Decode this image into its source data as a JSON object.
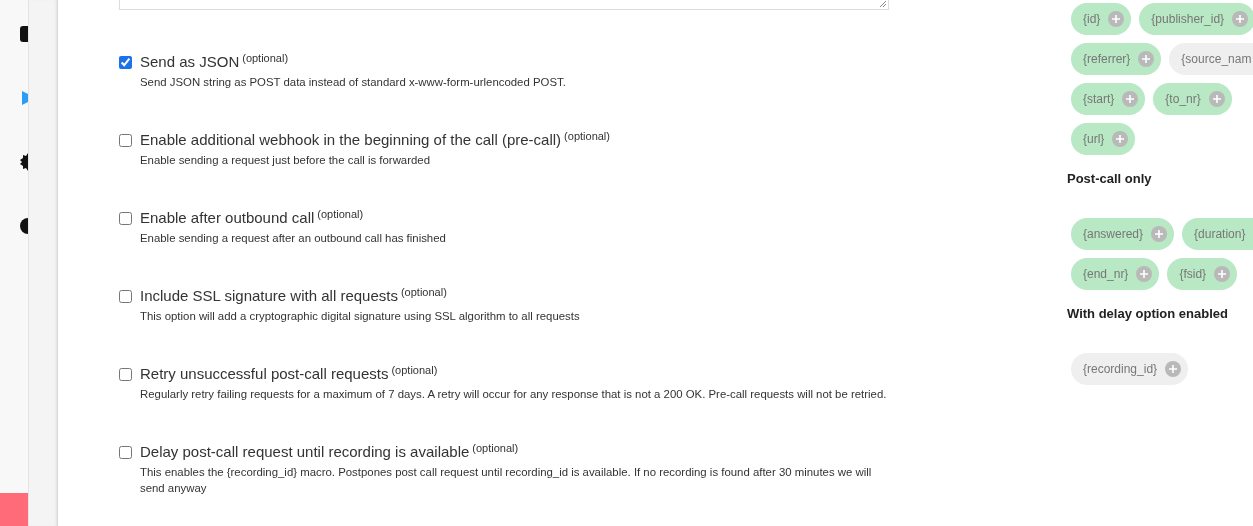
{
  "sidebar": {
    "icons": [
      {
        "kind": "square",
        "color": "#111111"
      },
      {
        "kind": "play",
        "color": "#2a9df4"
      },
      {
        "kind": "gear",
        "color": "#111111"
      },
      {
        "kind": "circle",
        "color": "#111111"
      }
    ]
  },
  "options": [
    {
      "label": "Send as JSON",
      "tag": "(optional)",
      "description": "Send JSON string as POST data instead of standard x-www-form-urlencoded POST.",
      "checked": true
    },
    {
      "label": "Enable additional webhook in the beginning of the call (pre-call)",
      "tag": "(optional)",
      "description": "Enable sending a request just before the call is forwarded",
      "checked": false
    },
    {
      "label": "Enable after outbound call",
      "tag": "(optional)",
      "description": "Enable sending a request after an outbound call has finished",
      "checked": false
    },
    {
      "label": "Include SSL signature with all requests",
      "tag": "(optional)",
      "description": "This option will add a cryptographic digital signature using SSL algorithm to all requests",
      "checked": false
    },
    {
      "label": "Retry unsuccessful post-call requests",
      "tag": "(optional)",
      "description": "Regularly retry failing requests for a maximum of 7 days. A retry will occur for any response that is not a 200 OK. Pre-call requests will not be retried.",
      "checked": false
    },
    {
      "label": "Delay post-call request until recording is available",
      "tag": "(optional)",
      "description": "This enables the {recording_id} macro. Postpones post call request until recording_id is available. If no recording is found after 30 minutes we will send anyway",
      "checked": false
    }
  ],
  "macro_groups": [
    {
      "rows": [
        [
          {
            "text": "{id}",
            "color": "#b8e8c4"
          },
          {
            "text": "{publisher_id}",
            "color": "#b8e8c4"
          }
        ],
        [
          {
            "text": "{referrer}",
            "color": "#b8e8c4"
          },
          {
            "text": "{source_nam",
            "color": "#efefef"
          }
        ],
        [
          {
            "text": "{start}",
            "color": "#b8e8c4"
          },
          {
            "text": "{to_nr}",
            "color": "#b8e8c4"
          }
        ],
        [
          {
            "text": "{url}",
            "color": "#b8e8c4"
          }
        ]
      ]
    },
    {
      "heading": "Post-call only",
      "rows": [
        [
          {
            "text": "{answered}",
            "color": "#b8e8c4"
          },
          {
            "text": "{duration}",
            "color": "#b8e8c4"
          }
        ],
        [
          {
            "text": "{end_nr}",
            "color": "#b8e8c4"
          },
          {
            "text": "{fsid}",
            "color": "#b8e8c4"
          }
        ]
      ]
    },
    {
      "heading": "With delay option enabled",
      "rows": [
        [
          {
            "text": "{recording_id}",
            "color": "#efefef"
          }
        ]
      ]
    }
  ]
}
